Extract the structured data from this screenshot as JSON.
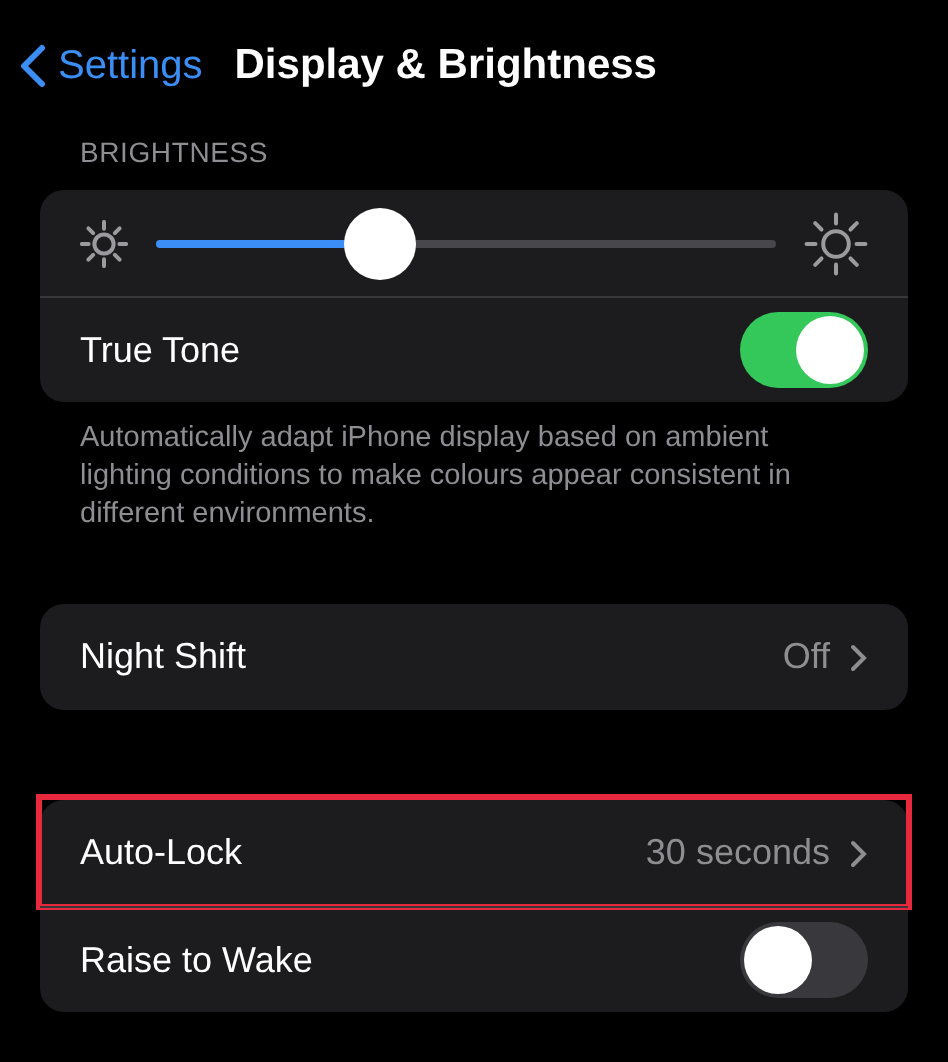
{
  "nav": {
    "back_label": "Settings",
    "title": "Display & Brightness"
  },
  "brightness": {
    "header": "BRIGHTNESS",
    "level": 0.36,
    "true_tone": {
      "label": "True Tone",
      "on": true
    },
    "footer": "Automatically adapt iPhone display based on ambient lighting conditions to make colours appear consistent in different environments."
  },
  "groups": [
    [
      {
        "kind": "value",
        "label": "Night Shift",
        "value": "Off",
        "highlighted": false
      }
    ],
    [
      {
        "kind": "value",
        "label": "Auto-Lock",
        "value": "30 seconds",
        "highlighted": true
      },
      {
        "kind": "toggle",
        "label": "Raise to Wake",
        "on": false
      }
    ]
  ]
}
